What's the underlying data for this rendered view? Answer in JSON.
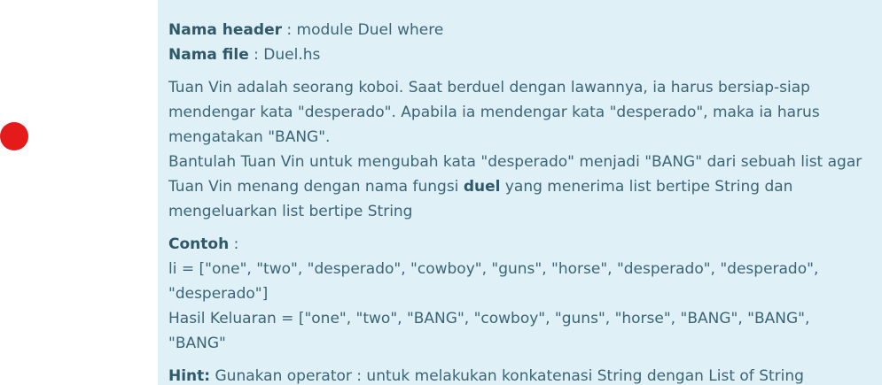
{
  "colors": {
    "panel_bg": "#dff0f7",
    "text": "#3b6577",
    "marker": "#e51b1b"
  },
  "header": {
    "name_label": "Nama header",
    "name_value": " : module Duel where",
    "file_label": "Nama file",
    "file_value": " : Duel.hs"
  },
  "description": {
    "line1": "Tuan Vin adalah seorang koboi. Saat berduel dengan lawannya, ia harus bersiap-siap",
    "line2": "mendengar kata \"desperado\". Apabila ia mendengar kata \"desperado\", maka ia harus",
    "line3": "mengatakan \"BANG\".",
    "line4": "Bantulah Tuan Vin untuk mengubah kata \"desperado\" menjadi \"BANG\" dari sebuah list agar",
    "line5_before": "Tuan Vin menang dengan nama fungsi ",
    "line5_bold": "duel",
    "line5_after": " yang menerima list bertipe String dan",
    "line6": "mengeluarkan list bertipe String"
  },
  "example": {
    "label": "Contoh",
    "label_suffix": " :",
    "input_line1": "li = [\"one\", \"two\", \"desperado\", \"cowboy\", \"guns\", \"horse\", \"desperado\", \"desperado\",",
    "input_line2": "\"desperado\"]",
    "output_line": "Hasil Keluaran = [\"one\", \"two\", \"BANG\", \"cowboy\", \"guns\", \"horse\", \"BANG\", \"BANG\", \"BANG\""
  },
  "hint": {
    "label": "Hint:",
    "text": " Gunakan operator : untuk melakukan konkatenasi String dengan List of String"
  }
}
